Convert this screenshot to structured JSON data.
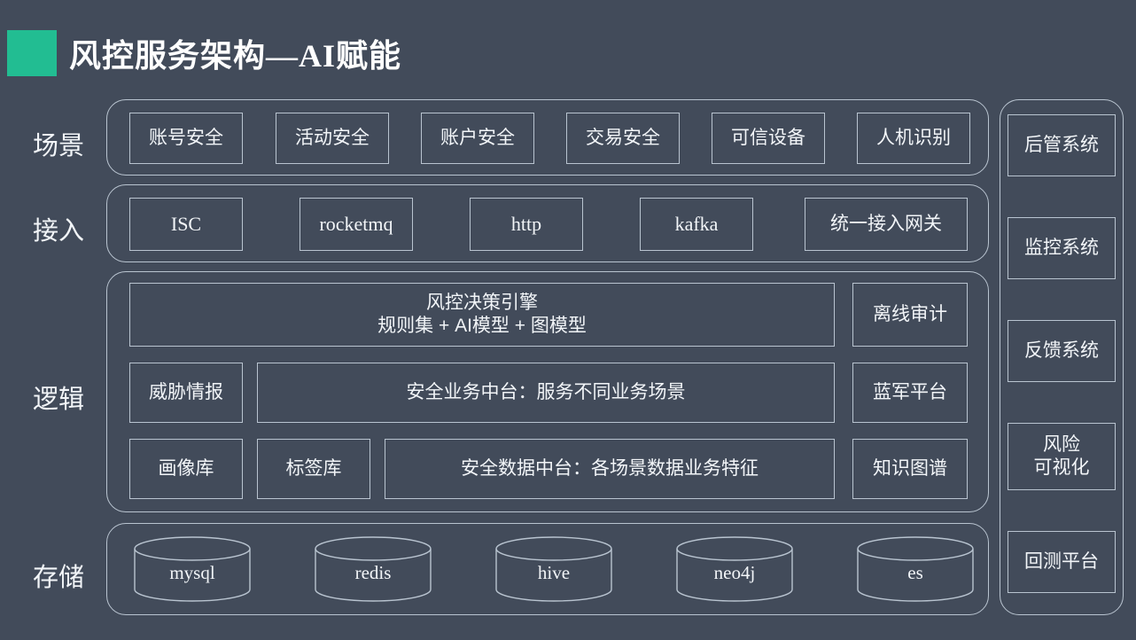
{
  "slide": {
    "title": "风控服务架构—AI赋能",
    "accent_color": "#22bd92",
    "background_color": "#424b5a",
    "border_color": "#b9c4d0",
    "text_color": "#f2f5f8"
  },
  "layers": [
    {
      "label": "场景",
      "items": [
        {
          "text": "账号安全"
        },
        {
          "text": "活动安全"
        },
        {
          "text": "账户安全"
        },
        {
          "text": "交易安全"
        },
        {
          "text": "可信设备"
        },
        {
          "text": "人机识别"
        }
      ]
    },
    {
      "label": "接入",
      "items": [
        {
          "text": "ISC"
        },
        {
          "text": "rocketmq"
        },
        {
          "text": "http"
        },
        {
          "text": "kafka"
        },
        {
          "text": "统一接入网关"
        }
      ]
    },
    {
      "label": "逻辑",
      "engine": {
        "line1": "风控决策引擎",
        "line2": "规则集 + AI模型 + 图模型"
      },
      "row2": {
        "left": "威胁情报",
        "center": "安全业务中台：服务不同业务场景"
      },
      "row3": {
        "left1": "画像库",
        "left2": "标签库",
        "center": "安全数据中台：各场景数据业务特征"
      },
      "right_column": [
        {
          "text": "离线审计"
        },
        {
          "text": "蓝军平台"
        },
        {
          "text": "知识图谱"
        }
      ]
    },
    {
      "label": "存储",
      "items": [
        {
          "text": "mysql"
        },
        {
          "text": "redis"
        },
        {
          "text": "hive"
        },
        {
          "text": "neo4j"
        },
        {
          "text": "es"
        }
      ]
    }
  ],
  "side_column": [
    {
      "text": "后管系统"
    },
    {
      "text": "监控系统"
    },
    {
      "text": "反馈系统"
    },
    {
      "text": "风险\n可视化"
    },
    {
      "text": "回测平台"
    }
  ]
}
